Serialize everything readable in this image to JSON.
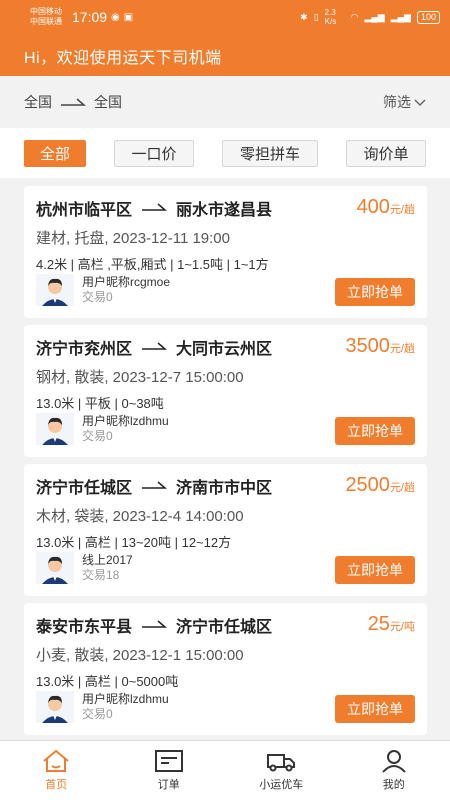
{
  "status": {
    "carrier1": "中国移动",
    "carrier2": "中国联通",
    "time": "17:09",
    "speed": "2.3 K/s",
    "battery": "100"
  },
  "header": {
    "welcome": "Hi，欢迎使用运天下司机端"
  },
  "route_filter": {
    "from": "全国",
    "to": "全国",
    "filter_label": "筛选"
  },
  "tabs": [
    "全部",
    "一口价",
    "零担拼车",
    "询价单"
  ],
  "orders": [
    {
      "route_from": "杭州市临平区",
      "route_to": "丽水市遂昌县",
      "price": "400",
      "unit": "元/趟",
      "goods": "建材, 托盘, 2023-12-11 19:00",
      "spec": "4.2米 | 高栏 ,平板,厢式 | 1~1.5吨 | 1~1方",
      "user": "用户昵称rcgmoe",
      "deals": "交易0",
      "button": "立即抢单"
    },
    {
      "route_from": "济宁市兖州区",
      "route_to": "大同市云州区",
      "price": "3500",
      "unit": "元/趟",
      "goods": "钢材, 散装, 2023-12-7 15:00:00",
      "spec": "13.0米 | 平板 | 0~38吨",
      "user": "用户昵称lzdhmu",
      "deals": "交易0",
      "button": "立即抢单"
    },
    {
      "route_from": "济宁市任城区",
      "route_to": "济南市市中区",
      "price": "2500",
      "unit": "元/趟",
      "goods": "木材, 袋装, 2023-12-4 14:00:00",
      "spec": "13.0米 | 高栏 | 13~20吨 | 12~12方",
      "user": "线上2017",
      "deals": "交易18",
      "button": "立即抢单"
    },
    {
      "route_from": "泰安市东平县",
      "route_to": "济宁市任城区",
      "price": "25",
      "unit": "元/吨",
      "goods": "小麦, 散装, 2023-12-1 15:00:00",
      "spec": "13.0米 | 高栏 | 0~5000吨",
      "user": "用户昵称lzdhmu",
      "deals": "交易0",
      "button": "立即抢单"
    }
  ],
  "nav": [
    "首页",
    "订单",
    "小运优车",
    "我的"
  ],
  "colors": {
    "accent": "#f07d2e"
  }
}
